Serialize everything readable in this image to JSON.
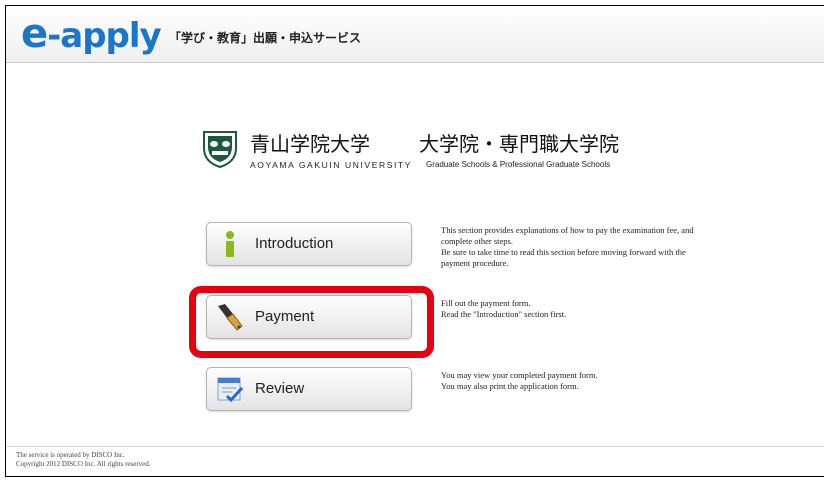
{
  "header": {
    "logo_e": "e",
    "logo_rest": "-apply",
    "tagline": "「学び・教育」出願・申込サービス",
    "logo_color": "#1976c8"
  },
  "university": {
    "name_jp": "青山学院大学",
    "grad_jp": "大学院・専門職大学院",
    "name_en": "AOYAMA GAKUIN UNIVERSITY",
    "grad_en": "Graduate Schools & Professional Graduate Schools",
    "crest_icon": "university-crest-icon"
  },
  "menu": [
    {
      "label": "Introduction",
      "icon": "info-icon",
      "desc": [
        "This section provides explanations of how to pay the examination fee, and",
        "complete other steps.",
        "Be sure to take time to read this section before moving forward with the",
        "payment procedure."
      ]
    },
    {
      "label": "Payment",
      "icon": "pen-icon",
      "desc": [
        "Fill out the payment form.",
        "Read the \"Introduction\" section first."
      ]
    },
    {
      "label": "Review",
      "icon": "form-check-icon",
      "desc": [
        "You may view your completed payment form.",
        "You may also print the application form."
      ]
    }
  ],
  "highlight_color": "#e8000e",
  "footer": {
    "line1": "The service is operated by DISCO Inc.",
    "line2": "Copyright 2012 DISCO Inc. All rights reserved."
  }
}
